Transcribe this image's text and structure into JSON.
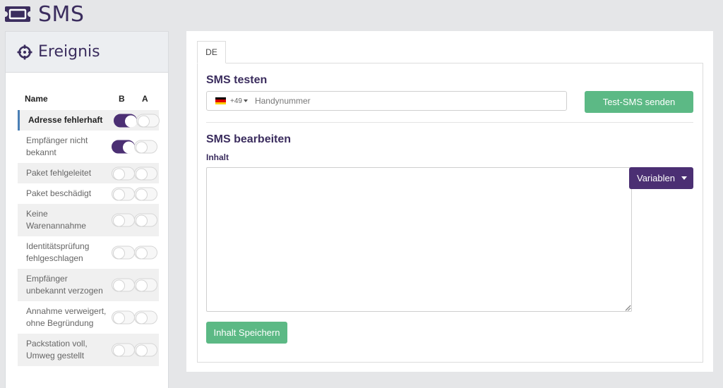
{
  "app": {
    "title": "SMS",
    "icon": "ticket-icon"
  },
  "sidebar": {
    "title": "Ereignis",
    "icon": "crosshair-icon",
    "columns": {
      "name": "Name",
      "b": "B",
      "a": "A"
    },
    "events": [
      {
        "label": "Adresse fehlerhaft",
        "b": true,
        "a": false,
        "active": true
      },
      {
        "label": "Empfänger nicht bekannt",
        "b": true,
        "a": false
      },
      {
        "label": "Paket fehlgeleitet",
        "b": false,
        "a": false
      },
      {
        "label": "Paket beschädigt",
        "b": false,
        "a": false
      },
      {
        "label": "Keine Warenannahme",
        "b": false,
        "a": false
      },
      {
        "label": "Identitätsprüfung fehlgeschlagen",
        "b": false,
        "a": false
      },
      {
        "label": "Empfänger unbekannt verzogen",
        "b": false,
        "a": false
      },
      {
        "label": "Annahme verweigert, ohne Begründung",
        "b": false,
        "a": false
      },
      {
        "label": "Packstation voll, Umweg gestellt",
        "b": false,
        "a": false
      }
    ]
  },
  "main": {
    "tab": "DE",
    "test": {
      "heading": "SMS testen",
      "dial_code": "+49",
      "phone_placeholder": "Handynummer",
      "phone_value": "",
      "send_label": "Test-SMS senden"
    },
    "edit": {
      "heading": "SMS bearbeiten",
      "content_label": "Inhalt",
      "content_value": "",
      "variables_label": "Variablen",
      "save_label": "Inhalt Speichern"
    }
  },
  "colors": {
    "brand": "#3b2d5e",
    "toggle_on": "#4b2f73",
    "green": "#5cb985",
    "active_border": "#4a7fb5"
  }
}
